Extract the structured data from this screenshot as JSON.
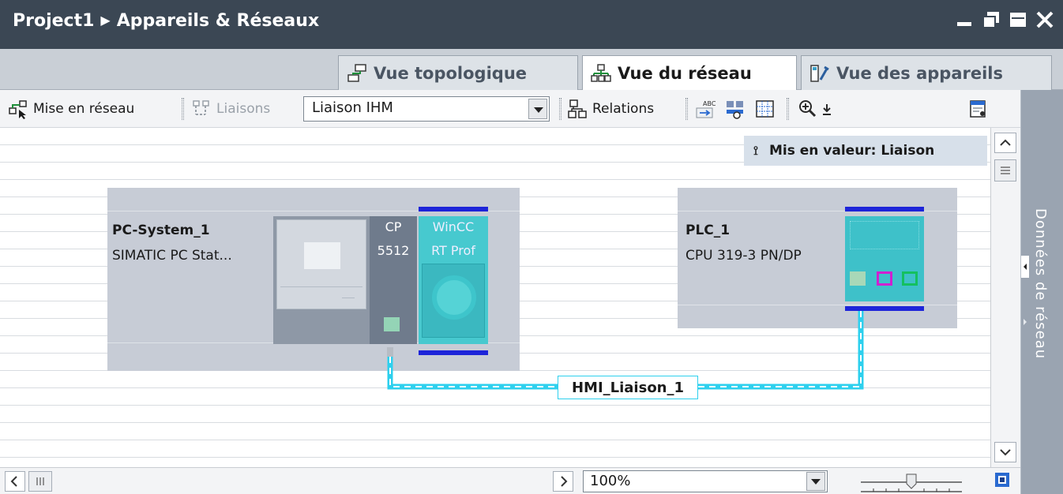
{
  "window": {
    "project": "Project1",
    "title": "Appareils & Réseaux"
  },
  "tabs": [
    {
      "label": "Vue topologique",
      "icon": "topology-view-icon",
      "active": false
    },
    {
      "label": "Vue du réseau",
      "icon": "network-view-icon",
      "active": true
    },
    {
      "label": "Vue des appareils",
      "icon": "device-view-icon",
      "active": false
    }
  ],
  "toolbar": {
    "network_label": "Mise en réseau",
    "connections_label": "Liaisons",
    "connection_type": "Liaison IHM",
    "relations_label": "Relations"
  },
  "tooltip": {
    "text": "Mis en valeur: Liaison"
  },
  "devices": {
    "pc": {
      "name": "PC-System_1",
      "type": "SIMATIC PC Stat...",
      "cp_line1": "CP",
      "cp_line2": "5512",
      "wincc_line1": "WinCC",
      "wincc_line2": "RT Prof"
    },
    "plc": {
      "name": "PLC_1",
      "type": "CPU 319-3 PN/DP"
    }
  },
  "connection": {
    "label": "HMI_Liaison_1",
    "color": "#3fd6ec"
  },
  "sidebar": {
    "label": "Données de réseau"
  },
  "zoom": {
    "value": "100%"
  },
  "colors": {
    "titlebar": "#3b4754",
    "device_panel": "#c7ccd6",
    "module_teal": "#3fc7c7",
    "rail_blue": "#1d24d9"
  }
}
